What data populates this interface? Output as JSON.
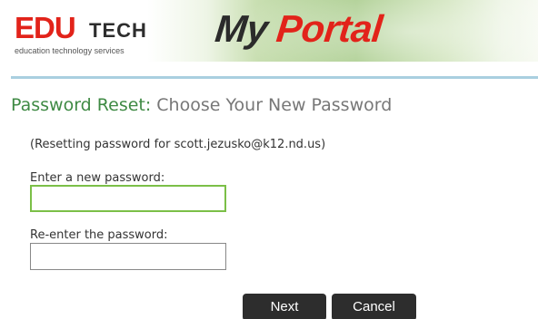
{
  "banner": {
    "logo_primary": "EDU",
    "logo_secondary": "TECH",
    "logo_tagline": "education technology services",
    "portal_word_1": "My",
    "portal_word_2": "Portal",
    "colors": {
      "brand_red": "#e2231a",
      "dark": "#2b2b2b",
      "rule_blue": "#a9cfe0"
    }
  },
  "page": {
    "title": "Password Reset:",
    "subtitle": "Choose Your New Password",
    "reset_note": "(Resetting password for scott.jezusko@k12.nd.us)",
    "title_color": "#3f8a44"
  },
  "form": {
    "new_password_label": "Enter a new password:",
    "new_password_value": "",
    "confirm_password_label": "Re-enter the password:",
    "confirm_password_value": "",
    "focus_color": "#7bbf47"
  },
  "actions": {
    "next_label": "Next",
    "cancel_label": "Cancel"
  }
}
